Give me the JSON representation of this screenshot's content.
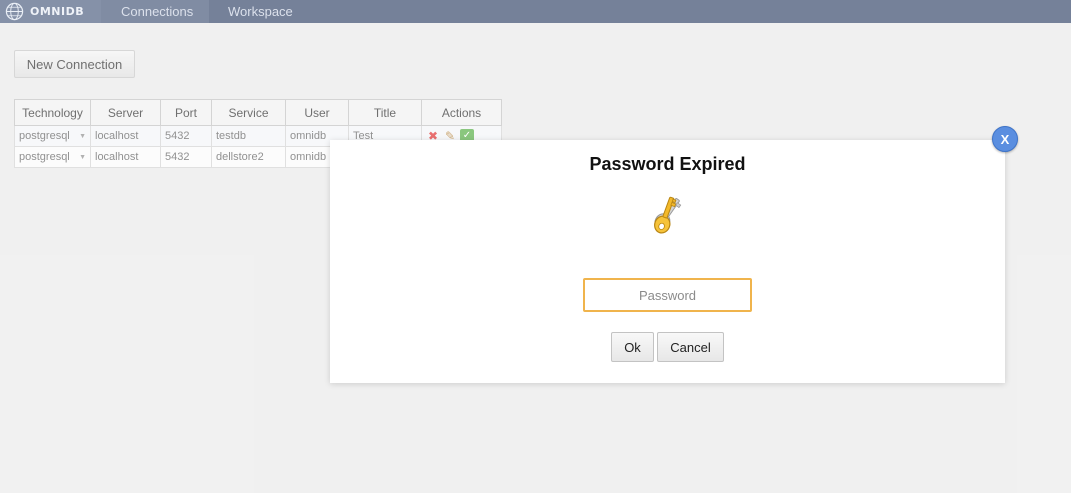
{
  "brand": {
    "logo_text": "OMNIDB",
    "logo_icon": "globe-icon"
  },
  "nav": {
    "tabs": [
      {
        "label": "Connections",
        "active": true
      },
      {
        "label": "Workspace",
        "active": false
      }
    ]
  },
  "toolbar": {
    "new_connection_label": "New Connection"
  },
  "table": {
    "headers": [
      "Technology",
      "Server",
      "Port",
      "Service",
      "User",
      "Title",
      "Actions"
    ],
    "rows": [
      {
        "technology": "postgresql",
        "server": "localhost",
        "port": "5432",
        "service": "testdb",
        "user": "omnidb",
        "title": "Test"
      },
      {
        "technology": "postgresql",
        "server": "localhost",
        "port": "5432",
        "service": "dellstore2",
        "user": "omnidb",
        "title": ""
      }
    ],
    "action_icons": [
      "delete-icon",
      "edit-icon",
      "test-icon"
    ]
  },
  "modal": {
    "title": "Password Expired",
    "icon": "key-icon",
    "password_placeholder": "Password",
    "password_value": "",
    "ok_label": "Ok",
    "cancel_label": "Cancel",
    "close_label": "X"
  },
  "colors": {
    "topbar": "#2c3e63",
    "input_focus_border": "#f0b44c",
    "close_button": "#5a8ee0"
  }
}
